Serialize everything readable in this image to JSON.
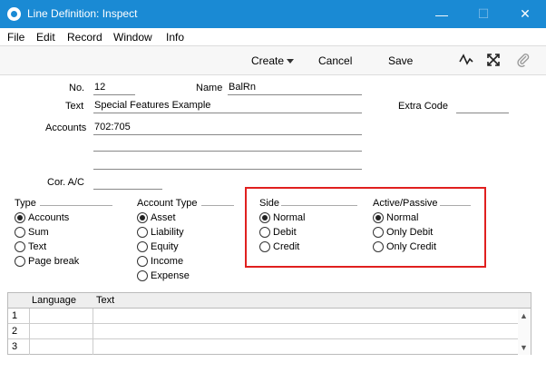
{
  "window": {
    "title": "Line Definition: Inspect",
    "minimize": "—",
    "maximize": "☐",
    "close": "✕"
  },
  "menu": [
    "File",
    "Edit",
    "Record",
    "Window",
    "Info"
  ],
  "toolbar": {
    "create": "Create",
    "cancel": "Cancel",
    "save": "Save"
  },
  "fields": {
    "no_label": "No.",
    "no_value": "12",
    "name_label": "Name",
    "name_value": "BalRn",
    "text_label": "Text",
    "text_value": "Special Features Example",
    "extra_code_label": "Extra Code",
    "extra_code_value": "",
    "accounts_label": "Accounts",
    "accounts_value": "702:705",
    "cor_ac_label": "Cor. A/C",
    "cor_ac_value": ""
  },
  "groups": {
    "type": {
      "title": "Type",
      "options": [
        "Accounts",
        "Sum",
        "Text",
        "Page break"
      ],
      "selected": 0
    },
    "account_type": {
      "title": "Account Type",
      "options": [
        "Asset",
        "Liability",
        "Equity",
        "Income",
        "Expense"
      ],
      "selected": 0
    },
    "side": {
      "title": "Side",
      "options": [
        "Normal",
        "Debit",
        "Credit"
      ],
      "selected": 0
    },
    "active_passive": {
      "title": "Active/Passive",
      "options": [
        "Normal",
        "Only Debit",
        "Only Credit"
      ],
      "selected": 0
    }
  },
  "grid": {
    "columns": [
      "Language",
      "Text"
    ],
    "rows": [
      "1",
      "2",
      "3"
    ]
  },
  "colors": {
    "titlebar": "#1a8ad4",
    "highlight": "#e0201f"
  }
}
